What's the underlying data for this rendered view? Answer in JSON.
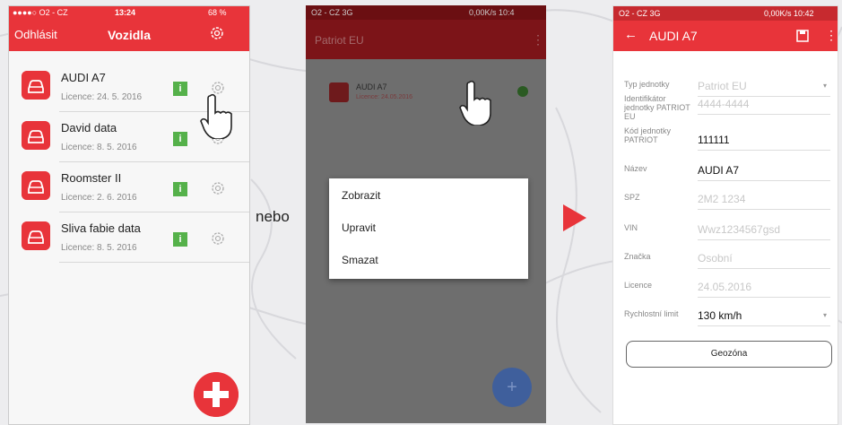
{
  "between_label": "nebo",
  "ios": {
    "status": {
      "carrier": "●●●●○ O2 - CZ",
      "time": "13:24",
      "battery": "68 %"
    },
    "nav": {
      "left": "Odhlásit",
      "title": "Vozidla"
    },
    "vehicles": [
      {
        "name": "AUDI A7",
        "licence": "Licence: 24. 5. 2016"
      },
      {
        "name": "David data",
        "licence": "Licence: 8. 5. 2016"
      },
      {
        "name": "Roomster II",
        "licence": "Licence: 2. 6. 2016"
      },
      {
        "name": "Sliva fabie data",
        "licence": "Licence: 8. 5. 2016"
      }
    ],
    "info_label": "i"
  },
  "android_a": {
    "status": {
      "carrier": "O2 - CZ 3G",
      "right": "0,00K/s 10:4"
    },
    "toolbar_title": "Patriot EU",
    "row": {
      "name": "AUDI A7",
      "licence": "Licence: 24.05.2016"
    },
    "menu": [
      "Zobrazit",
      "Upravit",
      "Smazat"
    ],
    "fab": "+"
  },
  "android_b": {
    "status": {
      "carrier": "O2 - CZ 3G",
      "right": "0,00K/s 10:42"
    },
    "toolbar_title": "AUDI A7",
    "fields": [
      {
        "label": "Typ jednotky",
        "value": "Patriot EU",
        "filled": false
      },
      {
        "label": "Identifikátor jednotky PATRIOT EU",
        "value": "4444-4444",
        "filled": false
      },
      {
        "label": "Kód jednotky PATRIOT",
        "value": "111111",
        "filled": true
      },
      {
        "label": "Název",
        "value": "AUDI A7",
        "filled": true
      },
      {
        "label": "SPZ",
        "value": "2M2 1234",
        "filled": false
      },
      {
        "label": "VIN",
        "value": "Wwz1234567gsd",
        "filled": false
      },
      {
        "label": "Značka",
        "value": "Osobní",
        "filled": false
      },
      {
        "label": "Licence",
        "value": "24.05.2016",
        "filled": false
      },
      {
        "label": "Rychlostní limit",
        "value": "130 km/h",
        "filled": true
      }
    ],
    "button": "Geozóna"
  },
  "colors": {
    "accent": "#e8343a",
    "info_green": "#55b14a"
  }
}
